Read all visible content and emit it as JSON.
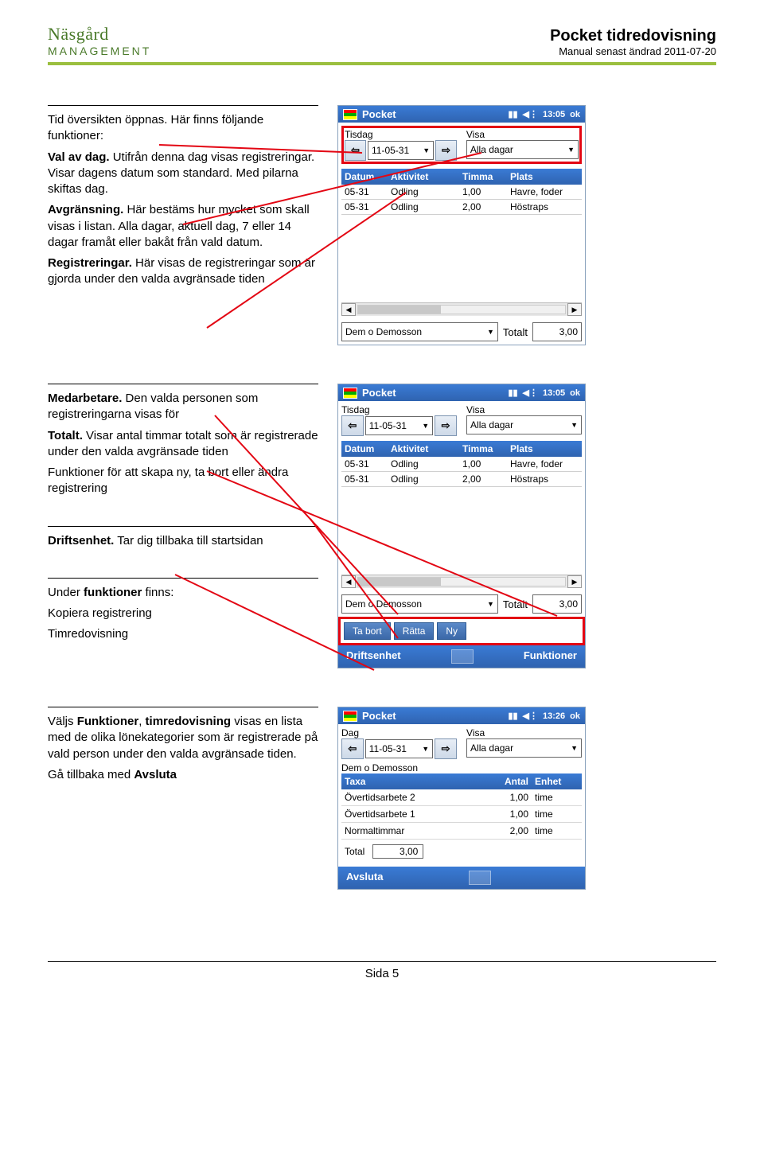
{
  "header": {
    "logo_top": "Näsgård",
    "logo_bottom": "MANAGEMENT",
    "title": "Pocket tidredovisning",
    "subtitle": "Manual senast ändrad 2011-07-20"
  },
  "section1": {
    "intro": "Tid översikten öppnas. Här finns följande funktioner:",
    "p1_bold": "Val av dag.",
    "p1": " Utifrån denna dag visas registreringar. Visar dagens datum som standard. Med pilarna skiftas dag.",
    "p2_bold": "Avgränsning.",
    "p2": " Här bestäms hur mycket som skall visas i listan. Alla dagar, aktuell dag, 7 eller 14 dagar framåt eller bakåt från vald datum.",
    "p3_bold": "Registreringar.",
    "p3": " Här visas de registreringar som är gjorda under den valda avgränsade tiden"
  },
  "section2": {
    "p1_bold": "Medarbetare.",
    "p1": " Den valda personen som registreringarna visas för",
    "p2_bold": "Totalt.",
    "p2": " Visar antal timmar totalt som är registrerade under den valda avgränsade tiden",
    "p3": "Funktioner för att skapa ny, ta bort eller ändra registrering"
  },
  "section3": {
    "p1_bold": "Driftsenhet.",
    "p1": " Tar dig tillbaka till startsidan",
    "p2_lead": "Under ",
    "p2_bold": "funktioner",
    "p2_tail": " finns:",
    "p3": "Kopiera registrering",
    "p4": "Timredovisning"
  },
  "section4": {
    "lead": "Väljs ",
    "b1": "Funktioner",
    "mid": ", ",
    "b2": "timredovisning",
    "tail": " visas en lista med de olika lönekategorier som är registrerade på vald person under den valda avgränsade tiden.",
    "last_lead": "Gå tillbaka med ",
    "last_bold": "Avsluta"
  },
  "phone_common": {
    "app": "Pocket",
    "ok": "ok",
    "time1": "13:05",
    "time2": "13:05",
    "time3": "13:26",
    "day_label": "Tisdag",
    "dag_label": "Dag",
    "visa_label": "Visa",
    "date": "11-05-31",
    "visa_value": "Alla dagar",
    "col_datum": "Datum",
    "col_aktivitet": "Aktivitet",
    "col_timma": "Timma",
    "col_plats": "Plats",
    "row1": {
      "d": "05-31",
      "a": "Odling",
      "t": "1,00",
      "p": "Havre, foder"
    },
    "row2": {
      "d": "05-31",
      "a": "Odling",
      "t": "2,00",
      "p": "Höstraps"
    },
    "person": "Dem o Demosson",
    "total_label": "Totalt",
    "total_value": "3,00",
    "btn_tabort": "Ta bort",
    "btn_ratta": "Rätta",
    "btn_ny": "Ny",
    "menu_driftsenhet": "Driftsenhet",
    "menu_funktioner": "Funktioner",
    "menu_avsluta": "Avsluta"
  },
  "phone3": {
    "col_taxa": "Taxa",
    "col_antal": "Antal",
    "col_enhet": "Enhet",
    "rows": [
      {
        "taxa": "Övertidsarbete 2",
        "antal": "1,00",
        "enhet": "time"
      },
      {
        "taxa": "Övertidsarbete 1",
        "antal": "1,00",
        "enhet": "time"
      },
      {
        "taxa": "Normaltimmar",
        "antal": "2,00",
        "enhet": "time"
      }
    ],
    "total_label": "Total",
    "total_value": "3,00"
  },
  "footer": {
    "page": "Sida 5"
  }
}
